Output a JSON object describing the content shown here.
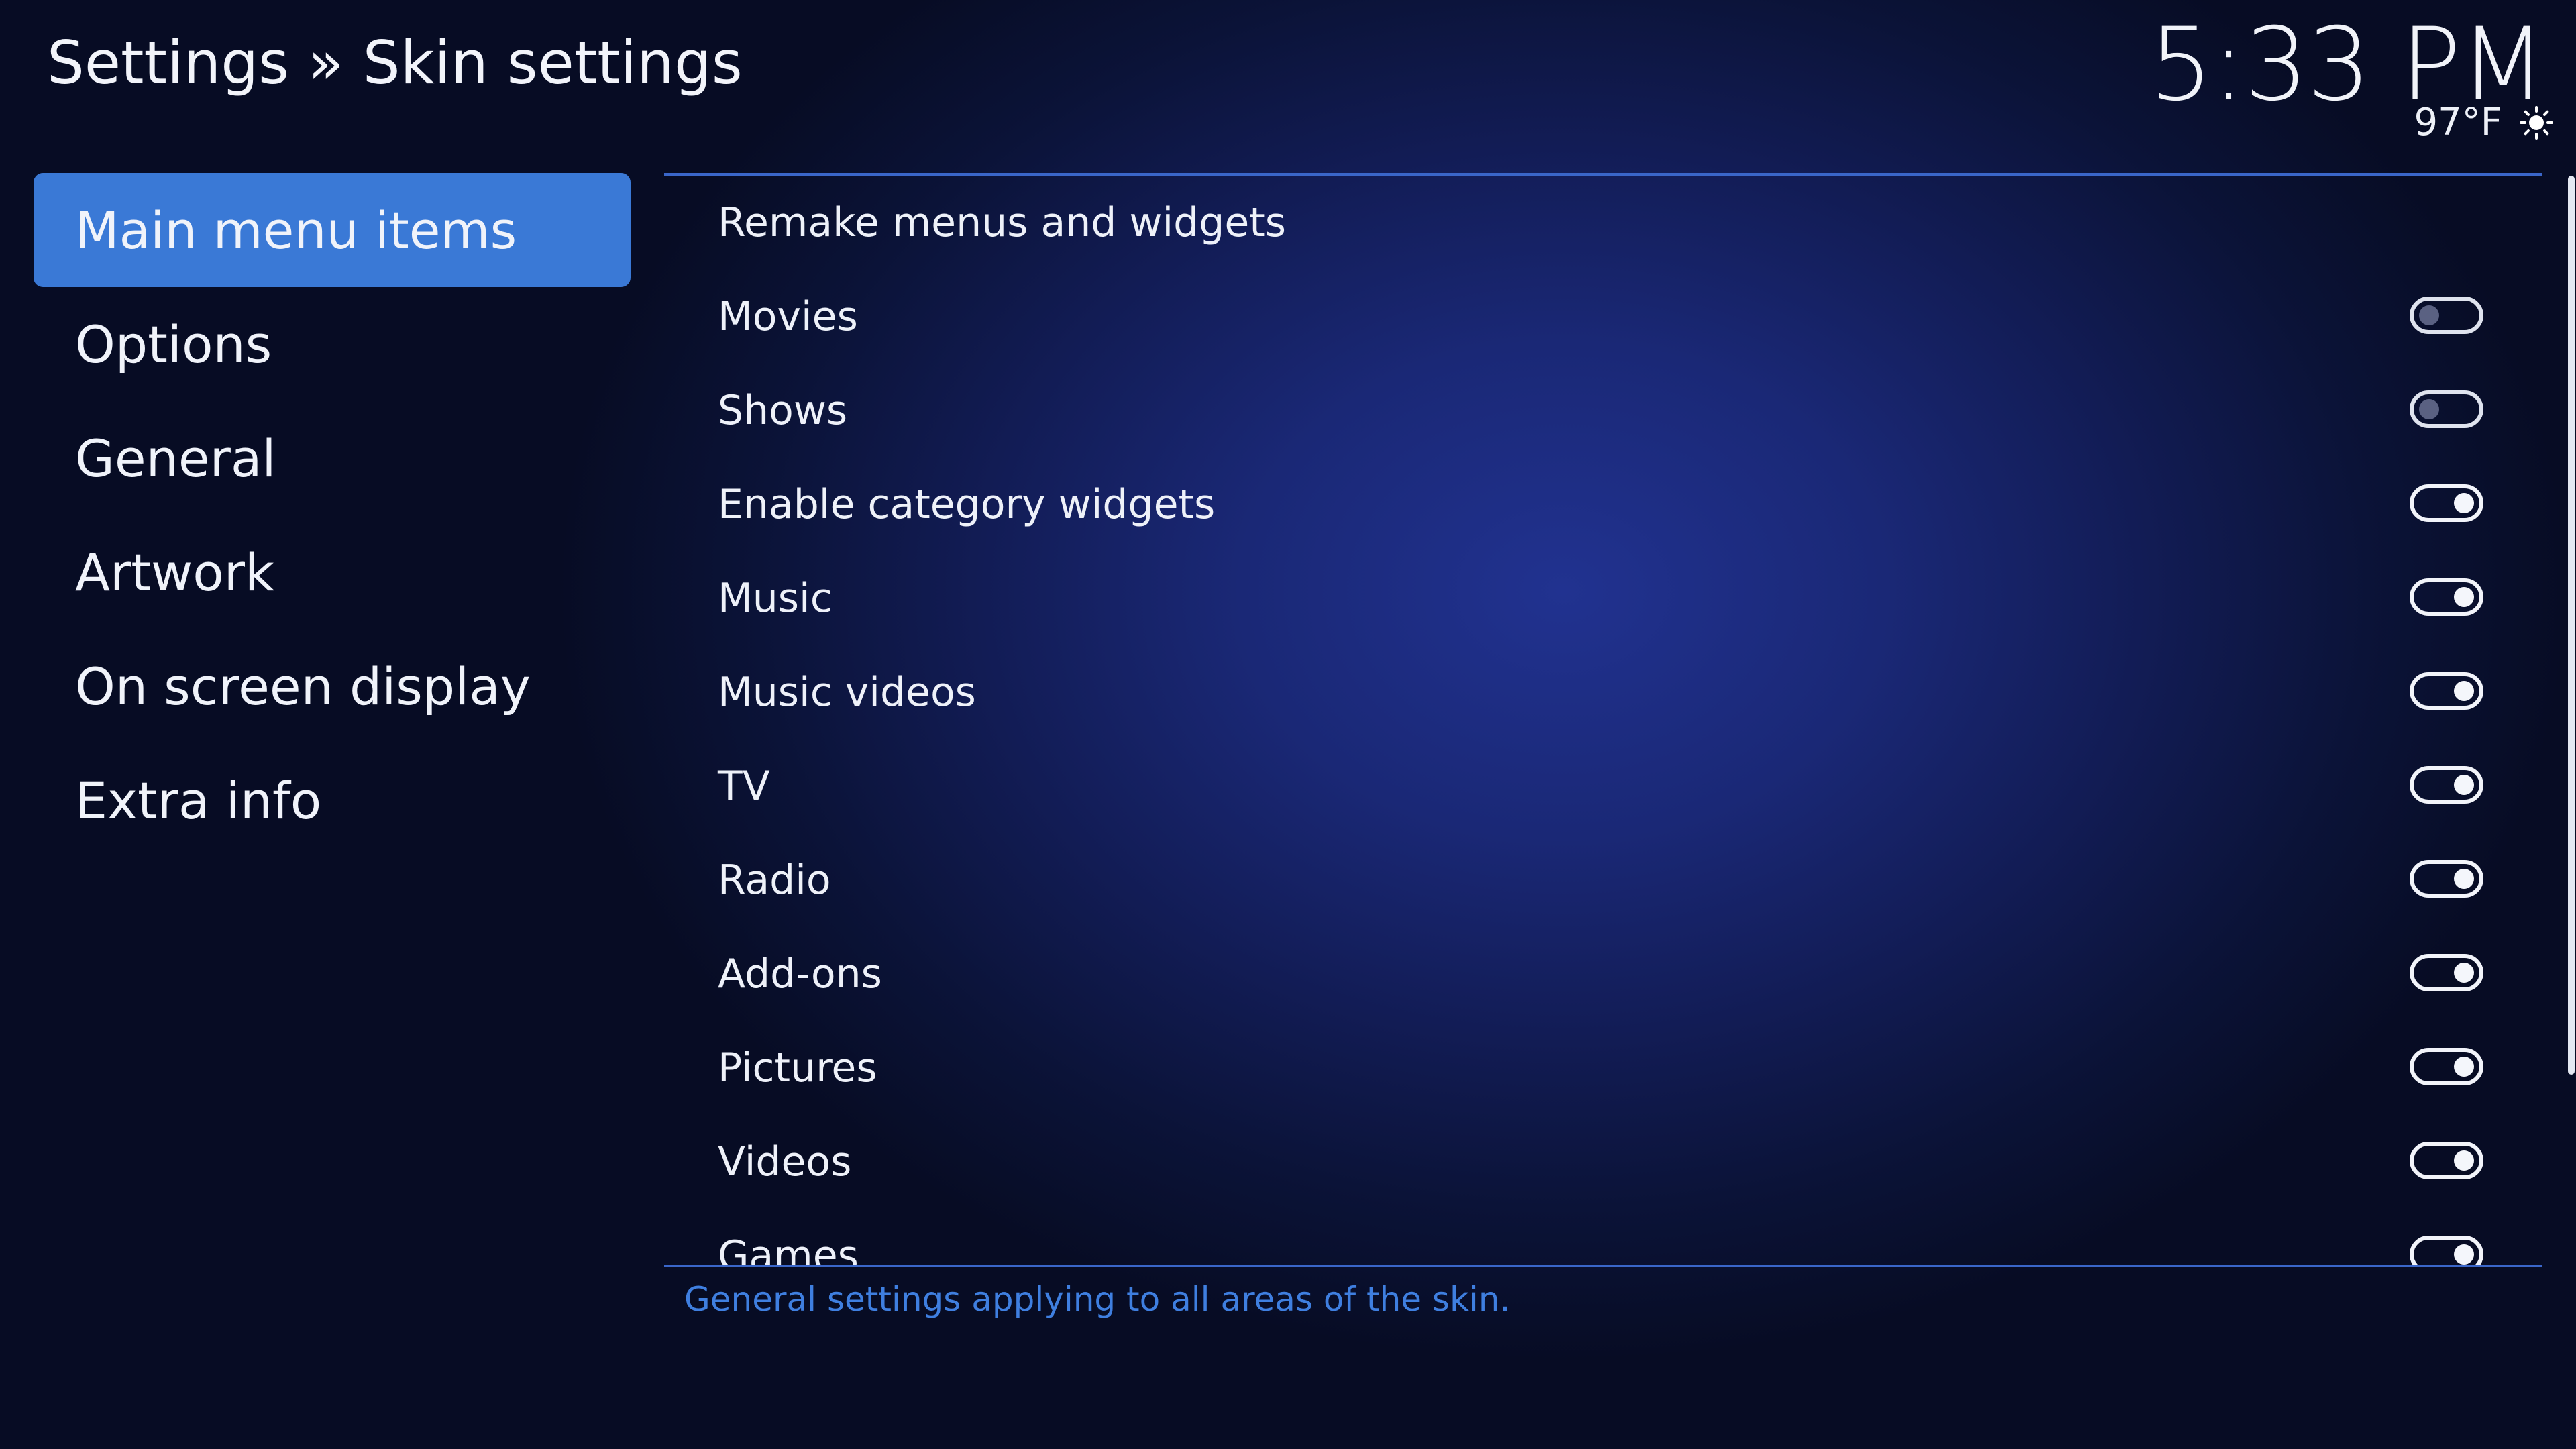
{
  "header": {
    "title": "Settings » Skin settings",
    "time": "5:33 PM",
    "temperature": "97°F",
    "weather_icon": "sun-icon"
  },
  "sidebar": {
    "items": [
      {
        "label": "Main menu items",
        "active": true
      },
      {
        "label": "Options",
        "active": false
      },
      {
        "label": "General",
        "active": false
      },
      {
        "label": "Artwork",
        "active": false
      },
      {
        "label": "On screen display",
        "active": false
      },
      {
        "label": "Extra info",
        "active": false
      }
    ]
  },
  "settings": {
    "rows": [
      {
        "label": "Remake menus and widgets"
      },
      {
        "label": "Movies",
        "toggle": "off"
      },
      {
        "label": "Shows",
        "toggle": "off"
      },
      {
        "label": "Enable category widgets",
        "toggle": "on"
      },
      {
        "label": "Music",
        "toggle": "on"
      },
      {
        "label": "Music videos",
        "toggle": "on"
      },
      {
        "label": "TV",
        "toggle": "on"
      },
      {
        "label": "Radio",
        "toggle": "on"
      },
      {
        "label": "Add-ons",
        "toggle": "on"
      },
      {
        "label": "Pictures",
        "toggle": "on"
      },
      {
        "label": "Videos",
        "toggle": "on"
      },
      {
        "label": "Games",
        "toggle": "on"
      }
    ]
  },
  "footer": {
    "description": "General settings applying to all areas of the skin."
  },
  "colors": {
    "accent": "#3a79d6",
    "description_text": "#3f7fe0",
    "divider": "#3a66c9"
  }
}
